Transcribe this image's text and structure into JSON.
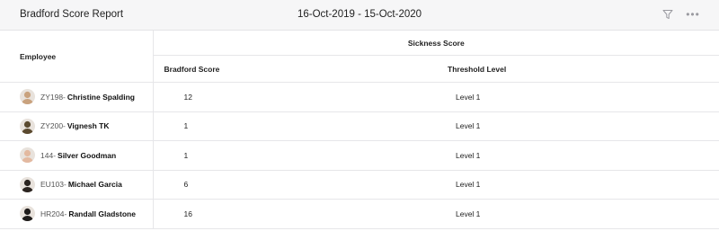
{
  "header": {
    "title": "Bradford Score Report",
    "date_range": "16-Oct-2019 - 15-Oct-2020",
    "icons": [
      "filter-icon",
      "more-options-icon"
    ]
  },
  "table": {
    "employee_header": "Employee",
    "group_header": "Sickness Score",
    "bradford_header": "Bradford Score",
    "threshold_header": "Threshold Level",
    "rows": [
      {
        "id": "ZY198",
        "sep": " - ",
        "name": "Christine Spalding",
        "score": "12",
        "level": "Level 1",
        "avatar_color": "#c9a27e"
      },
      {
        "id": "ZY200",
        "sep": " - ",
        "name": "Vignesh TK",
        "score": "1",
        "level": "Level 1",
        "avatar_color": "#5b4a2f"
      },
      {
        "id": "144",
        "sep": " - ",
        "name": "Silver Goodman",
        "score": "1",
        "level": "Level 1",
        "avatar_color": "#e3b9a0"
      },
      {
        "id": "EU103",
        "sep": " - ",
        "name": "Michael Garcia",
        "score": "6",
        "level": "Level 1",
        "avatar_color": "#2b2420"
      },
      {
        "id": "HR204",
        "sep": " - ",
        "name": "Randall Gladstone",
        "score": "16",
        "level": "Level 1",
        "avatar_color": "#1f1c1a"
      }
    ]
  },
  "colors": {
    "header_bg": "#f6f6f7",
    "border": "#e6e6e9",
    "icon_gray": "#9a9aa0"
  }
}
